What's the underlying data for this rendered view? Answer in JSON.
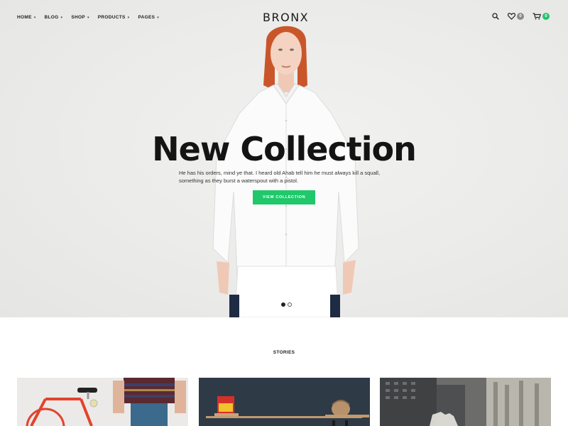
{
  "header": {
    "logo_text": "BRONX",
    "nav": [
      {
        "label": "HOME"
      },
      {
        "label": "BLOG"
      },
      {
        "label": "SHOP"
      },
      {
        "label": "PRODUCTS"
      },
      {
        "label": "PAGES"
      }
    ],
    "wishlist_count": "0",
    "cart_count": "0",
    "icons": [
      "search-icon",
      "heart-icon",
      "cart-icon"
    ]
  },
  "hero": {
    "title": "New Collection",
    "text_line1": "He has his orders, mind ye that. I heard old Ahab tell him he must always kill a squall,",
    "text_line2": "something as they burst a waterspout with a pistol.",
    "button_label": "VIEW COLLECTION",
    "slides": 2,
    "active_slide": 1
  },
  "stories": {
    "title": "STORIES"
  },
  "colors": {
    "accent_green": "#1fc86a",
    "badge_grey": "#8a8a8a",
    "hero_bg": "#ebebea"
  }
}
